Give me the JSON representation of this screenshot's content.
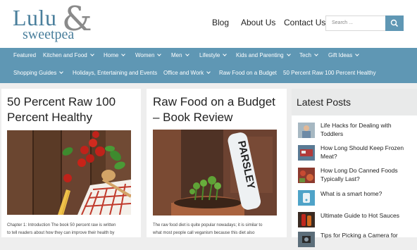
{
  "site": {
    "logo_word1": "Lulu",
    "logo_amp": "&",
    "logo_word2": "sweetpea"
  },
  "top_nav": [
    "Blog",
    "About Us",
    "Contact Us"
  ],
  "search": {
    "placeholder": "Search ..."
  },
  "main_nav_row1": [
    {
      "label": "Featured",
      "dropdown": false
    },
    {
      "label": "Kitchen and Food",
      "dropdown": true
    },
    {
      "label": "Home",
      "dropdown": true
    },
    {
      "label": "Women",
      "dropdown": true
    },
    {
      "label": "Men",
      "dropdown": true
    },
    {
      "label": "Lifestyle",
      "dropdown": true
    },
    {
      "label": "Kids and Parenting",
      "dropdown": true
    },
    {
      "label": "Tech",
      "dropdown": true
    },
    {
      "label": "Gift Ideas",
      "dropdown": true
    }
  ],
  "main_nav_row2": [
    {
      "label": "Shopping Guides",
      "dropdown": true
    },
    {
      "label": "Holidays, Entertaining and Events",
      "dropdown": false
    },
    {
      "label": "Office and Work",
      "dropdown": true
    },
    {
      "label": "Raw Food on a Budget",
      "dropdown": false
    },
    {
      "label": "50 Percent Raw 100 Percent Healthy",
      "dropdown": false
    }
  ],
  "articles": [
    {
      "title_line1": "50 Percent Raw 100",
      "title_line2": "Percent Healthy",
      "excerpt_line1": "Chapter 1: Introduction The book 50 percent raw is written",
      "excerpt_line2": "to tell readers about how they can improve their health by"
    },
    {
      "title_line1": "Raw Food on a Budget",
      "title_line2": "– Book Review",
      "image_sign_text": "PARSLEY",
      "excerpt_line1": "The raw food diet is quite popular nowadays; it is similar to",
      "excerpt_line2": "what most people call veganism because this diet also"
    }
  ],
  "sidebar": {
    "title": "Latest Posts",
    "posts": [
      {
        "line1": "Life Hacks for Dealing with",
        "line2": "Toddlers"
      },
      {
        "line1": "How Long Should Keep Frozen",
        "line2": "Meat?"
      },
      {
        "line1": "How Long Do Canned Foods",
        "line2": "Typically Last?"
      },
      {
        "line1": "What is a smart home?",
        "line2": ""
      },
      {
        "line1": "Ultimate Guide to Hot Sauces",
        "line2": ""
      },
      {
        "line1": "Tips for Picking a Camera for",
        "line2": ""
      }
    ]
  },
  "colors": {
    "brand_blue": "#5f97b4",
    "logo_blue": "#4a7f9c",
    "logo_grey": "#8a8a8a"
  }
}
